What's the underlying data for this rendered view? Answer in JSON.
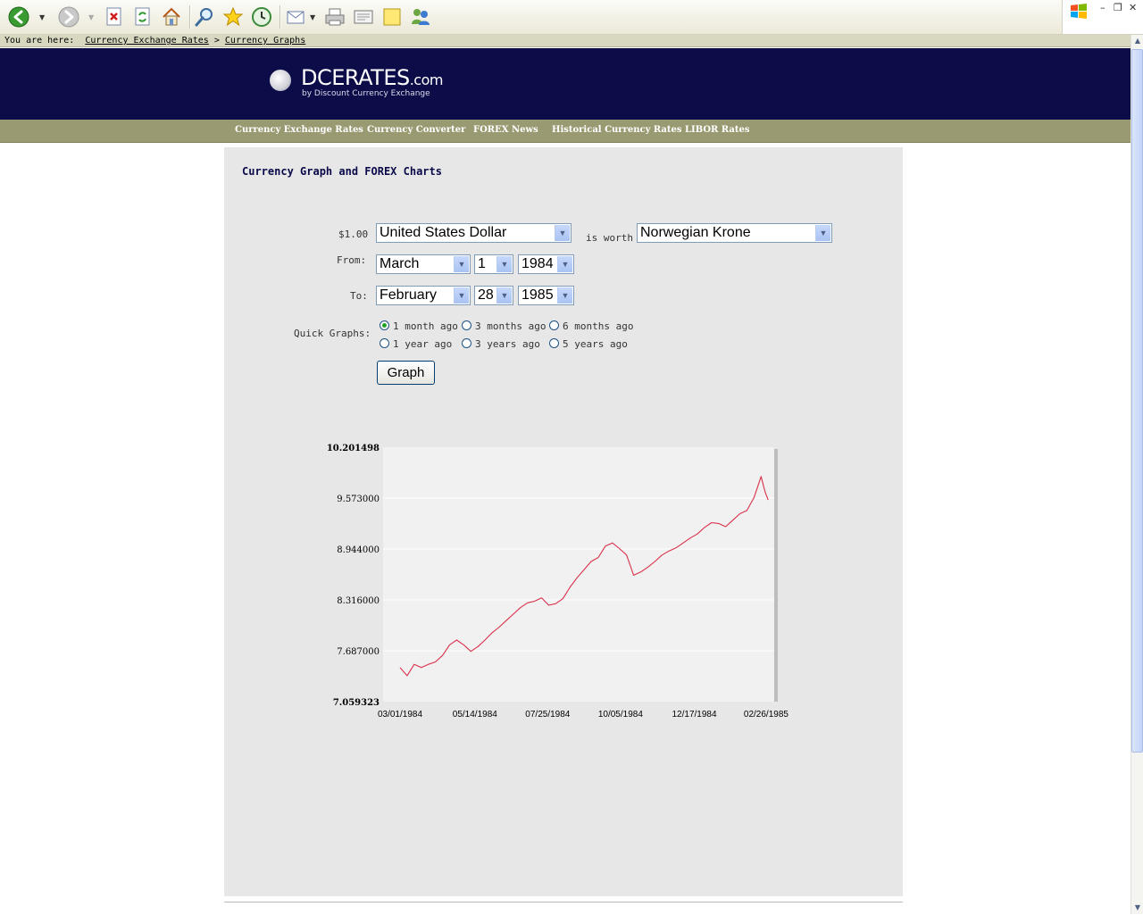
{
  "browser": {
    "toolbar_icons": [
      "back-icon",
      "forward-icon",
      "stop-icon",
      "refresh-icon",
      "home-icon",
      "search-icon",
      "favorites-icon",
      "history-icon",
      "mail-icon",
      "print-icon",
      "edit-icon",
      "note-icon",
      "messenger-icon"
    ]
  },
  "breadcrumb": {
    "prefix": "You are here:",
    "link1": "Currency Exchange Rates",
    "separator": ">",
    "link2": "Currency Graphs"
  },
  "site": {
    "brand_main": "DCERATES",
    "brand_suffix": ".com",
    "tagline": "by Discount Currency Exchange",
    "banner_color": "#0c0c48",
    "nav_color": "#9a9a72"
  },
  "nav": {
    "items": [
      "Currency Exchange Rates",
      "Currency Converter",
      "FOREX News",
      "Historical Currency Rates",
      "LIBOR Rates"
    ]
  },
  "main": {
    "title": "Currency Graph and FOREX Charts",
    "amount_label": "$1.00",
    "from_currency": "United States Dollar",
    "is_worth_label": "is worth",
    "to_currency": "Norwegian Krone",
    "from_label": "From:",
    "from_month": "March",
    "from_day": "1",
    "from_year": "1984",
    "to_label": "To:",
    "to_month": "February",
    "to_day": "28",
    "to_year": "1985",
    "quick_label": "Quick Graphs:",
    "quick_options": [
      "1 month ago",
      "3 months ago",
      "6 months ago",
      "1 year ago",
      "3 years ago",
      "5 years ago"
    ],
    "quick_selected": "1 month ago",
    "graph_button": "Graph"
  },
  "chart_data": {
    "type": "line",
    "title": "",
    "xlabel": "",
    "ylabel": "",
    "series_color": "#d9304a",
    "y_ticks": [
      "10.201498",
      "9.573000",
      "8.944000",
      "8.316000",
      "7.687000",
      "7.059323"
    ],
    "ylim": [
      7.059323,
      10.201498
    ],
    "x_ticks": [
      "03/01/1984",
      "05/14/1984",
      "07/25/1984",
      "10/05/1984",
      "12/17/1984",
      "02/26/1985"
    ],
    "series": [
      {
        "x": [
          "1984-03-01",
          "1984-03-08",
          "1984-03-15",
          "1984-03-22",
          "1984-03-29",
          "1984-04-05",
          "1984-04-12",
          "1984-04-19",
          "1984-04-26",
          "1984-05-03",
          "1984-05-10",
          "1984-05-17",
          "1984-05-24",
          "1984-05-31",
          "1984-06-07",
          "1984-06-14",
          "1984-06-21",
          "1984-06-28",
          "1984-07-05",
          "1984-07-12",
          "1984-07-19",
          "1984-07-26",
          "1984-08-02",
          "1984-08-09",
          "1984-08-16",
          "1984-08-23",
          "1984-08-30",
          "1984-09-06",
          "1984-09-13",
          "1984-09-20",
          "1984-09-27",
          "1984-10-04",
          "1984-10-11",
          "1984-10-18",
          "1984-10-25",
          "1984-11-01",
          "1984-11-08",
          "1984-11-15",
          "1984-11-22",
          "1984-11-29",
          "1984-12-06",
          "1984-12-13",
          "1984-12-20",
          "1984-12-27",
          "1985-01-03",
          "1985-01-10",
          "1985-01-17",
          "1985-01-24",
          "1985-01-31",
          "1985-02-07",
          "1985-02-14",
          "1985-02-21",
          "1985-02-25",
          "1985-02-28"
        ],
        "values": [
          7.48,
          7.38,
          7.52,
          7.48,
          7.52,
          7.55,
          7.63,
          7.76,
          7.82,
          7.76,
          7.68,
          7.74,
          7.82,
          7.91,
          7.98,
          8.06,
          8.14,
          8.22,
          8.28,
          8.3,
          8.34,
          8.25,
          8.27,
          8.33,
          8.47,
          8.59,
          8.69,
          8.79,
          8.84,
          8.98,
          9.02,
          8.95,
          8.87,
          8.62,
          8.66,
          8.72,
          8.79,
          8.87,
          8.92,
          8.96,
          9.02,
          9.08,
          9.13,
          9.21,
          9.27,
          9.26,
          9.22,
          9.3,
          9.38,
          9.42,
          9.58,
          9.84,
          9.65,
          9.55
        ]
      }
    ]
  }
}
